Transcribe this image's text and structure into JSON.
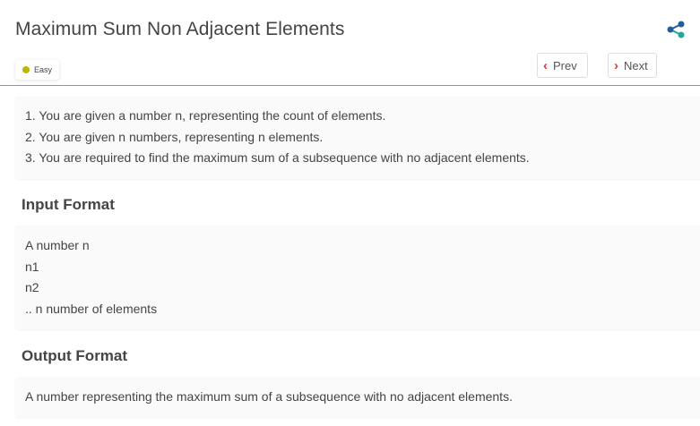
{
  "problem": {
    "title": "Maximum Sum Non Adjacent Elements",
    "difficulty": "Easy"
  },
  "nav": {
    "prev_label": "Prev",
    "next_label": "Next"
  },
  "description": {
    "lines": [
      "1. You are given a number n, representing the count of elements.",
      "2. You are given n numbers, representing n elements.",
      "3. You are required to find the maximum sum of a subsequence with no adjacent elements."
    ]
  },
  "input_format": {
    "heading": "Input Format",
    "lines": [
      "A number n",
      "n1",
      "n2",
      ".. n number of elements"
    ]
  },
  "output_format": {
    "heading": "Output Format",
    "lines": [
      "A number representing the maximum sum of a subsequence with no adjacent elements."
    ]
  },
  "colors": {
    "accent_red": "#e53935",
    "divider": "#e57373",
    "difficulty_dot": "#b8b800",
    "share_blue": "#1f5f9e",
    "share_teal": "#26a69a"
  },
  "icons": {
    "share": "share-icon",
    "prev": "chevron-left-icon",
    "next": "chevron-right-icon"
  }
}
